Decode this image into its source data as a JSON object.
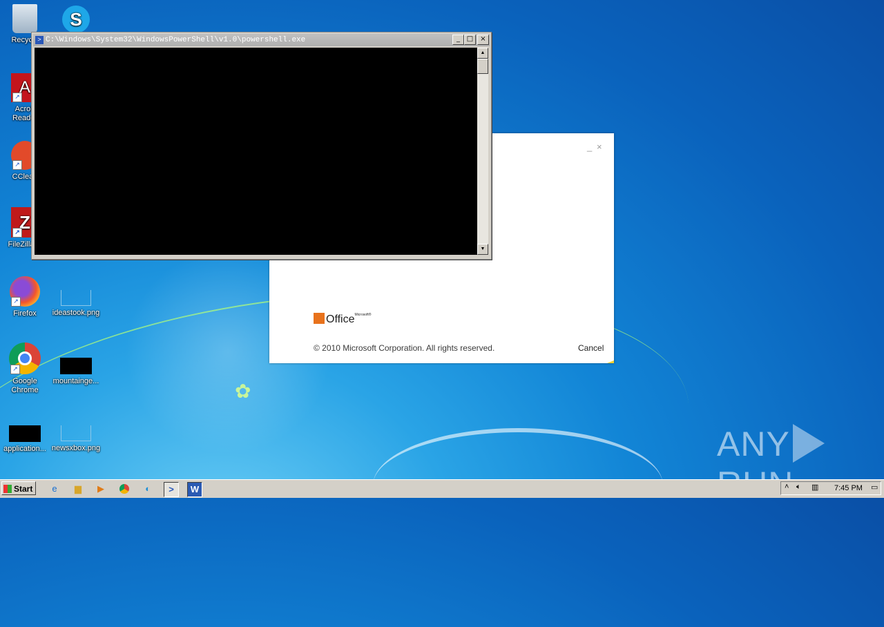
{
  "desktop": {
    "icons": [
      {
        "label": "Recycle",
        "icon": "recycle-bin-icon"
      },
      {
        "label": "",
        "icon": "skype-icon"
      },
      {
        "label": "Acrob\nReader",
        "icon": "acrobat-reader-icon"
      },
      {
        "label": "CClean",
        "icon": "ccleaner-icon"
      },
      {
        "label": "FileZilla C",
        "icon": "filezilla-icon"
      },
      {
        "label": "Firefox",
        "icon": "firefox-icon"
      },
      {
        "label": "ideastook.png",
        "icon": "png-file-icon"
      },
      {
        "label": "Google\nChrome",
        "icon": "chrome-icon"
      },
      {
        "label": "mountainge...",
        "icon": "png-file-icon"
      },
      {
        "label": "application...",
        "icon": "file-icon"
      },
      {
        "label": "newsxbox.png",
        "icon": "png-file-icon"
      }
    ]
  },
  "powershell": {
    "title": "C:\\Windows\\System32\\WindowsPowerShell\\v1.0\\powershell.exe",
    "minimize": "_",
    "maximize": "□",
    "close": "×"
  },
  "office": {
    "minimize": "_",
    "close": "×",
    "logo_text": "Office",
    "logo_brand": "Microsoft®",
    "copyright": "© 2010 Microsoft Corporation.  All rights reserved.",
    "cancel": "Cancel"
  },
  "taskbar": {
    "start_label": "Start",
    "clock": "7:45 PM"
  },
  "watermark": {
    "left": "ANY",
    "right": "RUN"
  }
}
